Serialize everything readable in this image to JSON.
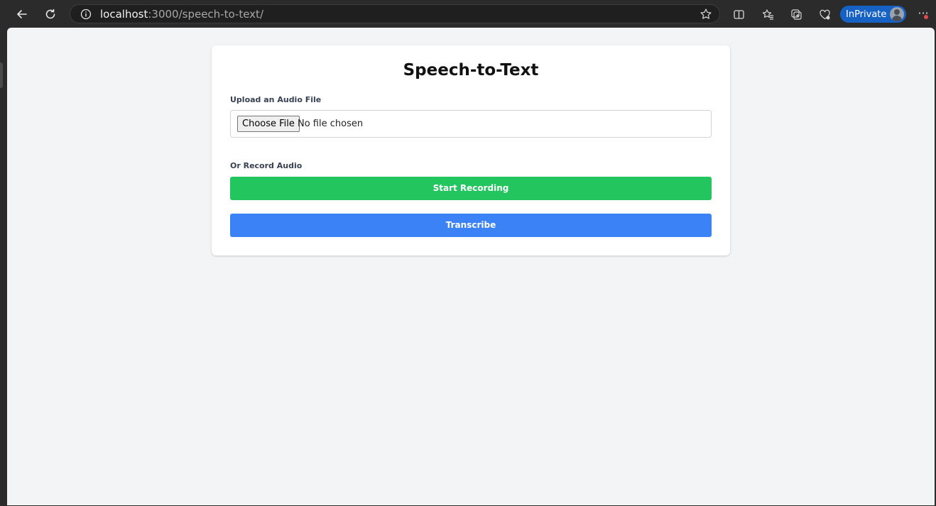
{
  "browser": {
    "url_host": "localhost",
    "url_path": ":3000/speech-to-text/",
    "inprivate_label": "InPrivate",
    "more_label": "···"
  },
  "page": {
    "title": "Speech-to-Text",
    "upload_label": "Upload an Audio File",
    "file_button_label": "Choose File",
    "file_status": "No file chosen",
    "record_label": "Or Record Audio",
    "record_button_label": "Start Recording",
    "transcribe_button_label": "Transcribe"
  },
  "colors": {
    "record_button": "#22c55e",
    "transcribe_button": "#3b82f6",
    "inprivate_badge": "#1662c4",
    "page_background": "#f3f4f6"
  }
}
